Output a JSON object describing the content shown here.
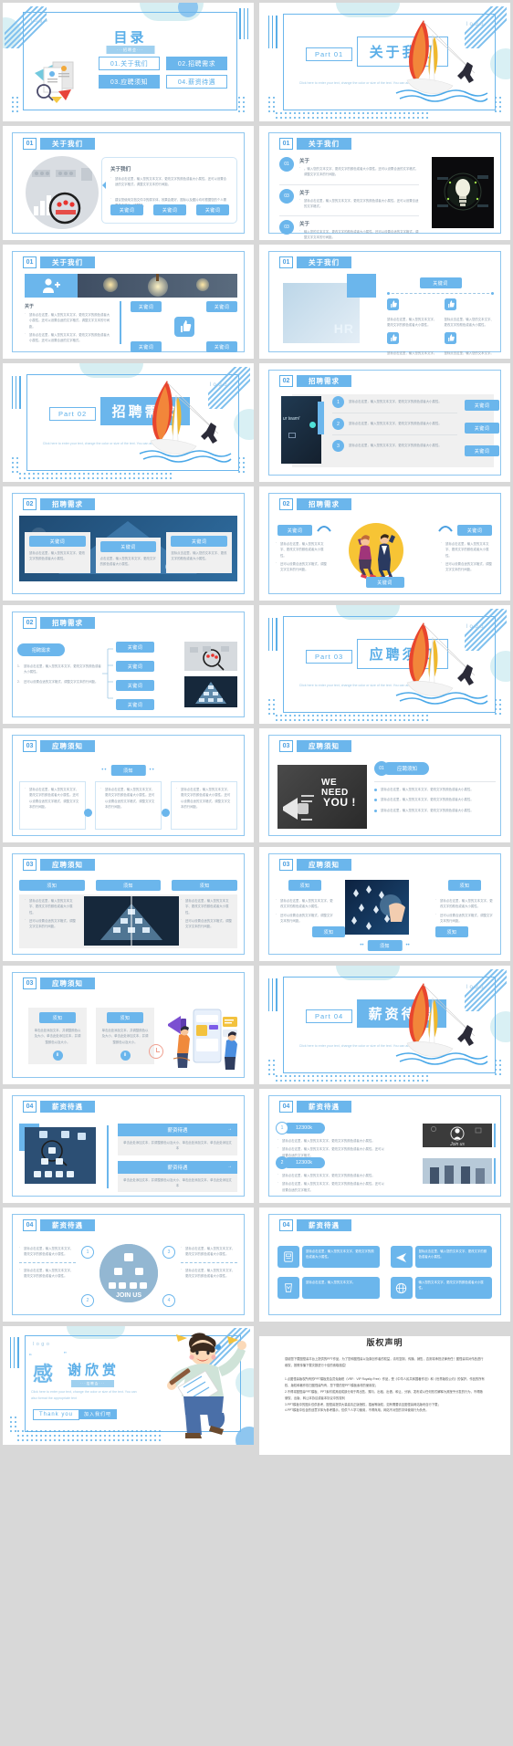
{
  "meta": {
    "logo": "logo",
    "brand_color": "#6bb6ec",
    "accent_color": "#5aaee8"
  },
  "toc": {
    "title": "目录",
    "subtitle": "···招聘会···",
    "items": [
      {
        "label": "01.关于我们",
        "style": "outline"
      },
      {
        "label": "02.招聘需求",
        "style": "filled"
      },
      {
        "label": "03.应聘须知",
        "style": "filled"
      },
      {
        "label": "04.薪资待遇",
        "style": "outline"
      }
    ]
  },
  "parts": [
    {
      "part": "Part 01",
      "title": "关于我们",
      "en": "Click here to enter your text, change the color or size of the text. You can also format"
    },
    {
      "part": "Part 02",
      "title": "招聘需求",
      "en": "Click here to enter your text, change the color or size of the text. You can also format"
    },
    {
      "part": "Part 03",
      "title": "应聘须知",
      "en": "Click here to enter your text, change the color or size of the text. You can also format"
    },
    {
      "part": "Part 04",
      "title": "薪资待遇",
      "en": "Click here to enter your text, change the color or size of the text. You can also format"
    }
  ],
  "sections": {
    "s01": {
      "num": "01",
      "title": "关于我们"
    },
    "s02": {
      "num": "02",
      "title": "招聘需求"
    },
    "s03": {
      "num": "03",
      "title": "应聘须知"
    },
    "s04": {
      "num": "04",
      "title": "薪资待遇"
    }
  },
  "labels": {
    "keyword": "关键词",
    "about": "关于我们",
    "about_short": "关于",
    "need": "招聘需求",
    "notice": "须知",
    "notice_full": "应聘须知",
    "salary": "薪资待遇",
    "arrow": "→",
    "amount": "12300k",
    "join_us": "JOIN US",
    "join_us2": "Join us",
    "we_need": "WE NEED",
    "you": "YOU !",
    "hr": "HR",
    "our_team": "ur team!"
  },
  "body_text": {
    "t1": "鼠标点击这里，输入您的文本文字、更改文字的颜色或者大小属性。还可以设置合适的文字格式，调整文字文本的行间距。",
    "t2": "建议您使用文档文件中的原字体，效果会更好，图标以及图片均可根据您的个人需要单击进行一键替换。",
    "t3": "。输入您的文本文字、更改文字的颜色或者大小属性。还可以设置合适的文字格式，调整文字文本的行间距。",
    "t4": "鼠标点击这里，输入您的文本文字、更改文字的颜色或者大小属性。还可以设置合适的文字格式。",
    "t5": "输入您的文本文字、更改文字的颜色或者大小属性。还可以设置合适的文字格式，调整文字文本的行间距。",
    "t6": "鼠标点击这里，输入您的文本文字、更改文字的颜色或者大小属性。",
    "t7": "鼠标点击这里，输入您的文本文字。",
    "t8": "鼠标点击这里，输入您的文本文字、更改文字的颜色或者大小属性。",
    "t9": "点击这里，输入您的文本文字、更改文字的颜色或者大小属性。",
    "t10": "还可以设置合适的文字格式，调整文字文本的行间距。",
    "t11": "单击此处添加文本，并调整颜色以及大小、单击此处添加文本，并调整颜色以及大小。",
    "t12": "单击此处添加文本，并调整颜色以及大小、单击此处添加文本，单击此处添加文本",
    "t13": "鼠标点击这里，输入您的文本文字、更改文字的颜色或者大小属性。",
    "t14": "输入您的文本文字、更改文字的颜色或者大小属性。"
  },
  "thanks": {
    "quote_open": "“",
    "quote_close": "”",
    "seal": "感",
    "title": "谢欣赏",
    "subtitle": "···招聘会···",
    "en": "Click here to enter your text, change the color or size of the text. You can also format the appropriate text",
    "btn1": "Thank you",
    "btn2": "加入我们吧"
  },
  "copyright": {
    "title": "版权声明",
    "p1": "感谢您下载图怪兽平台上提供的PPT作品，为了您和图怪兽以及原创作者的权益，请勿复制、传播、销售，否则将承担法律责任！图怪兽将对作品进行维权，按照传播下载次数进行十倍的索取赔偿！",
    "p2": "1.点图怪兽版权所有的PPT模板是会员免版税（VRF：VIP Royalty-Free）作品，受《中华人民共和国著作法》和《世界版权公约》的保护。作品的所有权、版权和著作权归图怪兽所有，您下载的是PPT模板素材的使用权；",
    "p3": "2.不得将图怪兽PPT模板、PPT素材或其组成部分用于再出售、赠与、出租、出借、和让、分销、发布或以任何形式解释为其授予分发的行为，不得随便权、出版、转让本协议或者本协议中的权利",
    "p4": "3.PPT模板中的图片仅供参考，图怪兽提供大量高清正版授权，插画等版权，如有需要请至图怪兽网站版块自行下载；",
    "p5": "4.PPT模板中包含的创意字体为参考展示，仅供个人学习使用，不得商用，网站不对您的字体使用行为负责。"
  }
}
